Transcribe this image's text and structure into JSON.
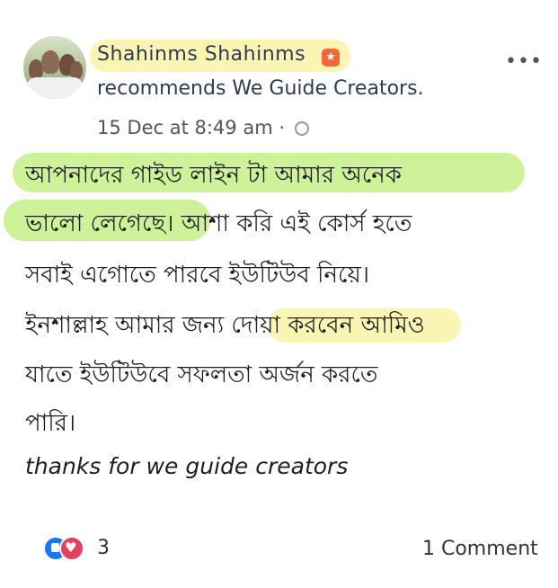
{
  "post": {
    "author": "Shahinms Shahinms",
    "recommend_text": "recommends We Guide Creators.",
    "timestamp": "15 Dec at 8:49 am ·",
    "body_lines": [
      "আপনাদের গাইড লাইন টা আমার অনেক",
      "ভালো লেগেছে। আশা করি এই কোর্স হতে",
      "সবাই এগোতে পারবে ইউটিউব নিয়ে।",
      "ইনশাল্লাহ আমার জন্য দোয়া করবেন আমিও",
      "যাতে ইউটিউবে সফলতা অর্জন করতে",
      "পারি।"
    ],
    "thanks_line": "thanks for we guide creators"
  },
  "footer": {
    "reaction_count": "3",
    "comments": "1 Comment"
  },
  "icons": {
    "more": "more-options-icon",
    "badge": "top-fan-badge-icon",
    "globe": "globe-icon",
    "like": "like-reaction-icon",
    "love": "love-reaction-icon"
  },
  "colors": {
    "highlight_green": "#cdf29a",
    "highlight_yellow": "#fbf5b4",
    "like_blue": "#1877f2",
    "love_red": "#e4405f"
  }
}
